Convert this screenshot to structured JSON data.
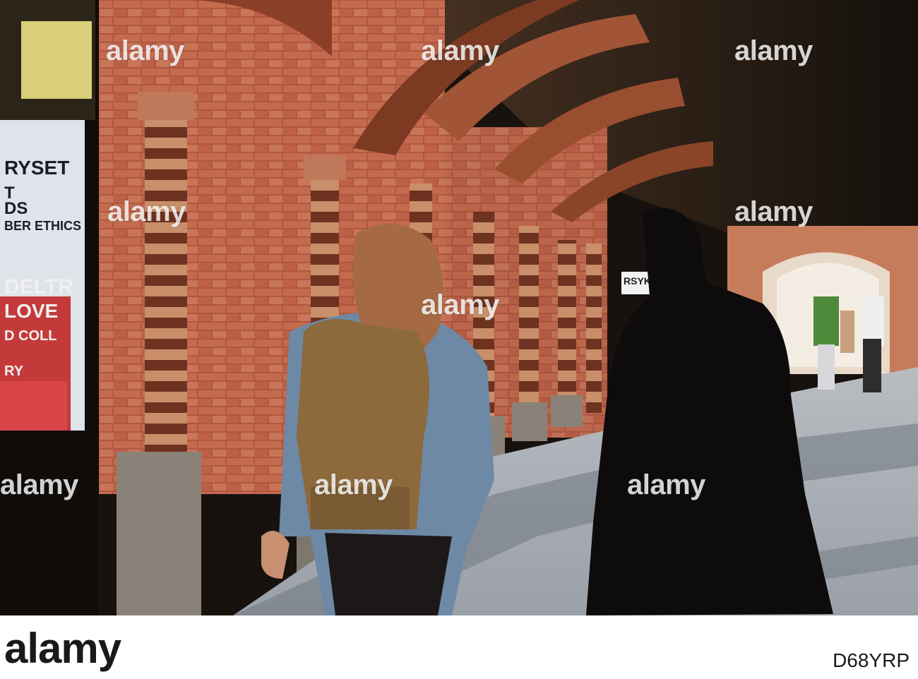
{
  "photo": {
    "watermark": "alamy",
    "poster_lines": [
      "RYSET",
      "T",
      "DS",
      "BER ETHICS",
      "DELTR",
      "LOVE",
      "D COLL",
      "RY"
    ],
    "sign_text": "RSYK"
  },
  "footer": {
    "logo": "alamy",
    "image_id": "D68YRP"
  }
}
